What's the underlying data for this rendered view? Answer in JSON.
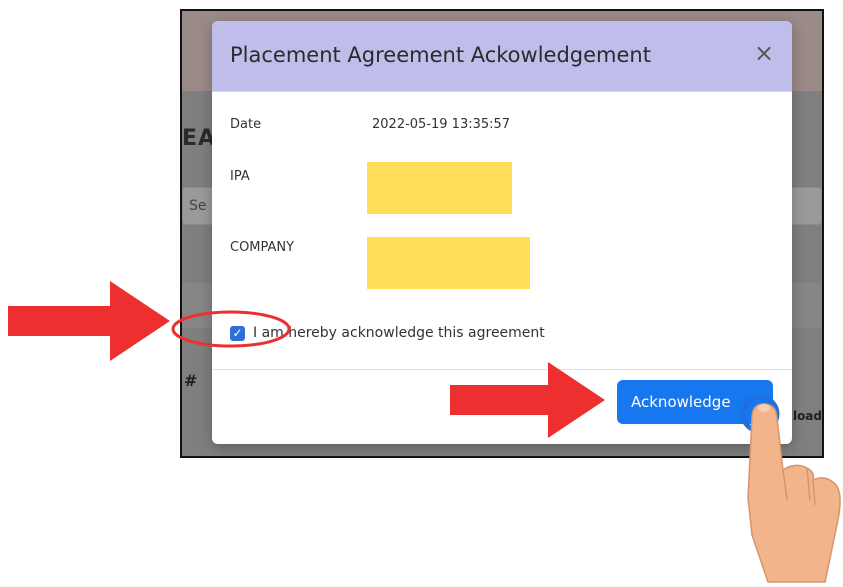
{
  "background_page": {
    "heading_fragment": "EA",
    "search_placeholder_fragment": "Se",
    "table_header_hash": "#",
    "upload_fragment": "load"
  },
  "modal": {
    "title": "Placement Agreement Ackowledgement",
    "close_symbol": "×",
    "date_label": "Date",
    "date_value": "2022-05-19 13:35:57",
    "ipa_label": "IPA",
    "company_label": "COMPANY",
    "checkbox_checked": true,
    "checkbox_label": "I am hereby acknowledge this agreement",
    "submit_label": "Acknowledge"
  },
  "icons": {
    "close": "close-icon",
    "check": "checkmark-icon",
    "tap": "tap-hand-icon"
  },
  "colors": {
    "header_bg": "#bfbdea",
    "button_blue": "#1677ef",
    "redaction_yellow": "#ffdf5a",
    "annotation_red": "#ee2f2f",
    "annotation_blue": "#1e6fe0",
    "skin": "#f2b48a"
  }
}
